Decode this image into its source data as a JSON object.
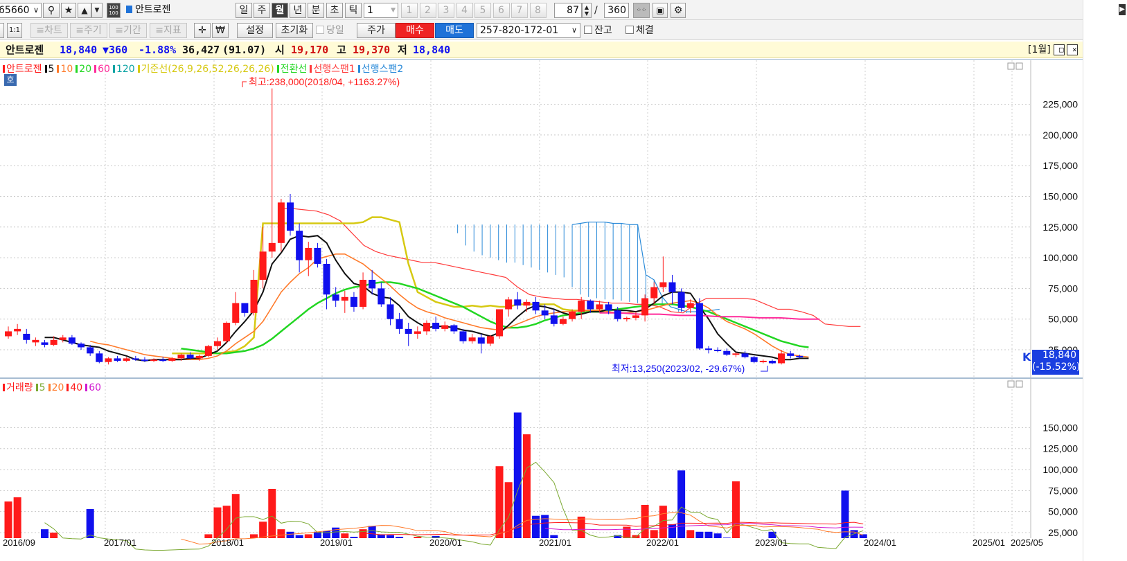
{
  "toolbar1": {
    "code": "65660",
    "stock_name": "안트로젠",
    "periods": [
      "일",
      "주",
      "월",
      "년",
      "분",
      "초",
      "틱"
    ],
    "tick_value": "1",
    "presets": [
      "1",
      "2",
      "3",
      "4",
      "5",
      "6",
      "7",
      "8"
    ],
    "count": "87",
    "separator": "/",
    "total": "360"
  },
  "toolbar2": {
    "ratio_label": "1:1",
    "tabs": [
      "≡차트",
      "≡주기",
      "≡기간",
      "≡지표"
    ],
    "won_sign": "₩",
    "settings": "설정",
    "reset": "초기화",
    "today": "당일",
    "price": "주가",
    "buy": "매수",
    "sell": "매도",
    "account": "257-820-172-01",
    "balance": "잔고",
    "execution": "체결"
  },
  "infobar": {
    "name": "안트로젠",
    "price": "18,840",
    "change": "▼360",
    "change_pct": "-1.88%",
    "volume": "36,427",
    "volume_ratio": "(91.07)",
    "open_label": "시",
    "open": "19,170",
    "high_label": "고",
    "high": "19,370",
    "low_label": "저",
    "low": "18,840",
    "period": "[1월]"
  },
  "colors": {
    "up": "#ff1a1a",
    "down": "#1010ee",
    "ma5": "#111111",
    "ma10": "#ff7a2a",
    "ma20": "#22d622",
    "ma60": "#ff2a9a",
    "ma120": "#0aa3a3",
    "base": "#d6c912",
    "conv": "#22d622",
    "span1": "#ff3a3a",
    "span2": "#2a8ad8"
  },
  "price_panel": {
    "legend": [
      "안트로젠",
      "5",
      "10",
      "20",
      "60",
      "120",
      "기준선(26,9,26,52,26,26,26)",
      "전환선",
      "선행스팬1",
      "선행스팬2"
    ],
    "tag": "호",
    "max_note": "최고:238,000(2018/04, +1163.27%)",
    "min_note": "최저:13,250(2023/02, -29.67%)",
    "current_price": "18,840",
    "current_pct": "(-15.52%)",
    "y_ticks": [
      "225,000",
      "200,000",
      "175,000",
      "150,000",
      "125,000",
      "100,000",
      "75,000",
      "50,000",
      "25,000"
    ]
  },
  "volume_panel": {
    "legend": [
      "거래량",
      "5",
      "20",
      "40",
      "60"
    ],
    "y_ticks": [
      "150,000",
      "125,000",
      "100,000",
      "75,000",
      "50,000",
      "25,000"
    ]
  },
  "x_labels": [
    "2016/09",
    "2017/01",
    "2018/01",
    "2019/01",
    "2020/01",
    "2021/01",
    "2022/01",
    "2023/01",
    "2024/01",
    "2025/01",
    "2025/05"
  ],
  "chart_data": {
    "type": "candlestick",
    "ylim": [
      0,
      250000
    ],
    "volume_ylim": [
      0,
      180000
    ],
    "candles": [
      [
        36,
        44,
        34,
        40,
        1
      ],
      [
        40,
        46,
        37,
        42,
        1
      ],
      [
        38,
        42,
        30,
        33,
        0
      ],
      [
        33,
        35,
        28,
        31,
        1
      ],
      [
        31,
        33,
        27,
        29,
        0
      ],
      [
        29,
        36,
        28,
        33,
        1
      ],
      [
        33,
        37,
        31,
        35,
        1
      ],
      [
        35,
        37,
        29,
        30,
        0
      ],
      [
        30,
        31,
        25,
        27,
        0
      ],
      [
        27,
        29,
        20,
        22,
        0
      ],
      [
        22,
        24,
        14,
        15,
        0
      ],
      [
        15,
        19,
        13,
        18,
        1
      ],
      [
        18,
        20,
        15,
        16,
        0
      ],
      [
        16,
        19,
        15,
        18,
        1
      ],
      [
        18,
        20,
        16,
        17,
        0
      ],
      [
        17,
        19,
        15,
        16,
        0
      ],
      [
        16,
        18,
        15,
        17,
        1
      ],
      [
        17,
        19,
        15,
        16,
        0
      ],
      [
        16,
        19,
        15,
        18,
        1
      ],
      [
        18,
        22,
        16,
        21,
        1
      ],
      [
        21,
        23,
        17,
        18,
        0
      ],
      [
        18,
        21,
        16,
        20,
        1
      ],
      [
        20,
        29,
        19,
        28,
        1
      ],
      [
        28,
        35,
        25,
        32,
        1
      ],
      [
        32,
        48,
        30,
        47,
        1
      ],
      [
        47,
        72,
        45,
        63,
        1
      ],
      [
        63,
        62,
        52,
        55,
        0
      ],
      [
        55,
        90,
        53,
        82,
        1
      ],
      [
        82,
        125,
        75,
        105,
        1
      ],
      [
        105,
        238,
        100,
        112,
        1
      ],
      [
        112,
        148,
        105,
        145,
        1
      ],
      [
        145,
        152,
        118,
        122,
        0
      ],
      [
        122,
        128,
        88,
        98,
        0
      ],
      [
        98,
        113,
        85,
        108,
        1
      ],
      [
        108,
        112,
        92,
        95,
        0
      ],
      [
        95,
        99,
        58,
        70,
        0
      ],
      [
        70,
        76,
        60,
        65,
        0
      ],
      [
        65,
        73,
        55,
        68,
        1
      ],
      [
        68,
        72,
        56,
        60,
        0
      ],
      [
        60,
        88,
        58,
        82,
        1
      ],
      [
        82,
        90,
        70,
        75,
        0
      ],
      [
        75,
        80,
        60,
        62,
        0
      ],
      [
        62,
        68,
        45,
        50,
        0
      ],
      [
        50,
        55,
        38,
        42,
        0
      ],
      [
        42,
        47,
        28,
        38,
        0
      ],
      [
        38,
        44,
        34,
        40,
        1
      ],
      [
        40,
        49,
        37,
        47,
        1
      ],
      [
        47,
        52,
        40,
        42,
        0
      ],
      [
        42,
        48,
        40,
        45,
        1
      ],
      [
        45,
        46,
        38,
        40,
        0
      ],
      [
        40,
        42,
        30,
        32,
        0
      ],
      [
        32,
        38,
        30,
        35,
        1
      ],
      [
        35,
        38,
        22,
        30,
        0
      ],
      [
        30,
        37,
        28,
        36,
        1
      ],
      [
        36,
        58,
        34,
        58,
        1
      ],
      [
        58,
        68,
        52,
        66,
        1
      ],
      [
        66,
        72,
        58,
        61,
        0
      ],
      [
        61,
        66,
        56,
        64,
        1
      ],
      [
        64,
        68,
        54,
        57,
        0
      ],
      [
        57,
        62,
        50,
        53,
        0
      ],
      [
        53,
        58,
        44,
        46,
        0
      ],
      [
        46,
        52,
        45,
        50,
        1
      ],
      [
        50,
        58,
        48,
        56,
        1
      ],
      [
        56,
        68,
        50,
        65,
        1
      ],
      [
        65,
        66,
        55,
        58,
        0
      ],
      [
        58,
        65,
        56,
        62,
        1
      ],
      [
        62,
        64,
        54,
        57,
        0
      ],
      [
        57,
        60,
        48,
        50,
        0
      ],
      [
        50,
        52,
        48,
        51,
        1
      ],
      [
        51,
        56,
        49,
        53,
        1
      ],
      [
        53,
        70,
        48,
        67,
        1
      ],
      [
        67,
        80,
        62,
        76,
        1
      ],
      [
        76,
        101,
        72,
        80,
        1
      ],
      [
        80,
        86,
        62,
        72,
        0
      ],
      [
        72,
        75,
        56,
        59,
        0
      ],
      [
        59,
        66,
        55,
        63,
        1
      ],
      [
        63,
        67,
        25,
        26,
        0
      ],
      [
        26,
        28,
        22,
        25,
        0
      ],
      [
        25,
        27,
        23,
        24,
        0
      ],
      [
        24,
        26,
        20,
        21,
        0
      ],
      [
        21,
        23,
        19,
        22,
        1
      ],
      [
        22,
        24,
        18,
        19,
        0
      ],
      [
        19,
        20,
        14,
        15,
        0
      ],
      [
        15,
        17,
        14,
        16,
        1
      ],
      [
        16,
        17,
        13.25,
        14,
        0
      ],
      [
        14,
        25,
        13,
        22,
        1
      ],
      [
        22,
        24,
        18,
        20,
        0
      ],
      [
        20,
        21,
        18,
        18.84,
        0
      ]
    ],
    "volume": [
      62,
      67,
      13,
      13,
      29,
      25,
      13,
      9,
      11,
      53,
      8,
      6,
      5,
      5,
      3,
      3,
      4,
      5,
      7,
      5,
      5,
      5,
      23,
      55,
      57,
      71,
      14,
      23,
      38,
      77,
      29,
      26,
      22,
      23,
      26,
      27,
      31,
      24,
      20,
      29,
      33,
      23,
      22,
      20,
      18,
      20,
      18,
      21,
      16,
      13,
      10,
      10,
      8,
      10,
      104,
      85,
      168,
      142,
      45,
      46,
      22,
      12,
      14,
      44,
      18,
      8,
      15,
      22,
      32,
      22,
      58,
      28,
      57,
      35,
      99,
      28,
      26,
      26,
      24,
      19,
      86,
      14,
      10,
      7,
      26,
      8,
      9,
      8,
      7,
      5,
      4,
      6,
      75,
      28,
      23
    ],
    "ma5": [
      null,
      null,
      null,
      null,
      35,
      35,
      33,
      31,
      29,
      28,
      27,
      24,
      22,
      20,
      17,
      16,
      17,
      17,
      17,
      17,
      18,
      18,
      21,
      24,
      31,
      40,
      48,
      57,
      72,
      95,
      104,
      115,
      118,
      117,
      118,
      112,
      98,
      87,
      79,
      77,
      71,
      68,
      67,
      61,
      52,
      47,
      43,
      44,
      44,
      43,
      41,
      40,
      38,
      36,
      39,
      45,
      52,
      58,
      61,
      60,
      58,
      55,
      53,
      54,
      56,
      56,
      58,
      57,
      57,
      56,
      58,
      63,
      69,
      72,
      72,
      71,
      60,
      50,
      38,
      30,
      23,
      22,
      21,
      20,
      19,
      17,
      17,
      18,
      18
    ],
    "ma10": [
      null,
      null,
      null,
      null,
      null,
      null,
      null,
      null,
      null,
      32,
      30,
      29,
      27,
      25,
      23,
      21,
      20,
      19,
      18,
      17,
      17,
      17,
      18,
      20,
      24,
      30,
      35,
      40,
      48,
      60,
      72,
      80,
      87,
      92,
      99,
      101,
      103,
      103,
      99,
      95,
      89,
      83,
      77,
      70,
      64,
      59,
      56,
      54,
      51,
      49,
      47,
      45,
      43,
      42,
      41,
      43,
      46,
      49,
      52,
      54,
      55,
      56,
      56,
      57,
      57,
      57,
      56,
      55,
      55,
      56,
      57,
      59,
      61,
      63,
      64,
      65,
      63,
      59,
      53,
      48,
      45,
      42,
      38,
      33,
      28,
      24,
      21,
      20,
      19
    ],
    "ma20": [
      null,
      null,
      null,
      null,
      null,
      null,
      null,
      null,
      null,
      null,
      null,
      null,
      null,
      null,
      null,
      null,
      null,
      null,
      null,
      26,
      25,
      24,
      23,
      22,
      22,
      23,
      24,
      26,
      29,
      34,
      40,
      46,
      52,
      58,
      63,
      67,
      71,
      74,
      76,
      77,
      79,
      80,
      80,
      79,
      77,
      75,
      72,
      69,
      66,
      63,
      60,
      56,
      52,
      48,
      45,
      43,
      43,
      44,
      46,
      49,
      51,
      53,
      54,
      55,
      56,
      56,
      57,
      58,
      59,
      60,
      61,
      62,
      62,
      62,
      61,
      60,
      58,
      56,
      53,
      50,
      47,
      44,
      41,
      38,
      35,
      32,
      30,
      28,
      27
    ],
    "ma60_tail": [
      55,
      55,
      54,
      54,
      53,
      53,
      52,
      52,
      51,
      51,
      50,
      50
    ],
    "base_line": [
      22,
      22,
      22,
      22,
      22,
      22,
      23,
      24,
      28,
      35,
      128,
      128,
      128,
      128,
      128,
      128,
      128,
      128,
      128,
      128,
      128,
      129,
      133,
      133,
      131,
      129,
      95,
      72,
      68,
      64,
      62,
      60,
      60,
      61,
      60,
      61,
      60,
      60,
      62,
      62,
      62,
      62,
      62,
      58,
      57,
      57,
      57,
      57,
      57
    ],
    "span1": [
      140,
      140,
      139,
      138,
      135,
      130,
      120,
      110,
      105,
      102,
      100,
      98,
      96,
      96,
      94,
      92,
      90,
      88,
      86,
      84,
      76,
      70,
      68,
      67,
      66,
      66,
      65,
      64,
      63,
      63,
      62,
      62,
      60,
      56,
      55,
      62,
      67,
      67,
      67,
      67,
      66,
      62,
      58,
      58,
      56,
      53,
      46,
      45,
      44,
      44
    ],
    "span2": [
      127,
      127,
      127,
      127,
      127,
      127,
      127,
      127,
      127,
      127,
      127,
      127,
      127,
      127,
      127,
      127,
      127,
      127,
      127,
      127,
      127,
      128,
      129,
      129,
      129,
      128,
      128,
      127,
      127,
      86,
      82,
      68,
      60,
      58,
      56,
      56,
      57,
      57,
      58
    ]
  }
}
